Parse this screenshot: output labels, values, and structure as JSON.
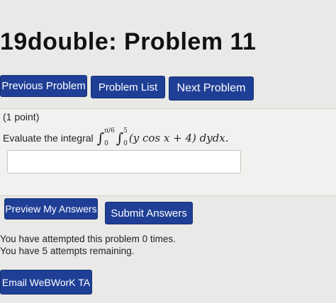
{
  "page": {
    "title": "19double: Problem 11"
  },
  "nav": {
    "previous_label": "Previous Problem",
    "list_label": "Problem List",
    "next_label": "Next Problem"
  },
  "problem": {
    "points": "(1 point)",
    "statement_prefix": "Evaluate the integral",
    "outer_upper": "π/6",
    "outer_lower": "0",
    "inner_upper": "5",
    "inner_lower": "0",
    "integrand": "(y cos x + 4) dydx."
  },
  "answer": {
    "value": ""
  },
  "actions": {
    "preview_label": "Preview My Answers",
    "submit_label": "Submit Answers"
  },
  "attempts": {
    "line1": "You have attempted this problem 0 times.",
    "line2": "You have 5 attempts remaining."
  },
  "footer": {
    "email_label": "Email WeBWorK TA"
  },
  "colors": {
    "button_bg": "#1f3f97",
    "button_text": "#ffffff",
    "page_bg": "#e9e9e7"
  }
}
